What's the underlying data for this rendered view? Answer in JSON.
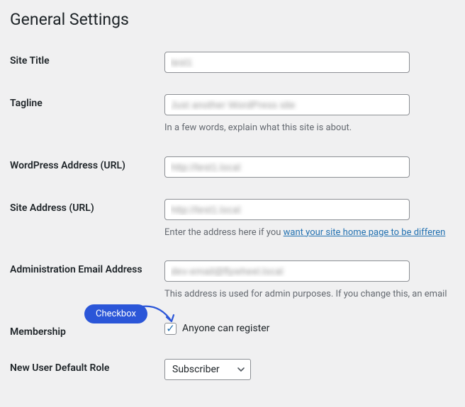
{
  "page_title": "General Settings",
  "fields": {
    "site_title": {
      "label": "Site Title",
      "value": "test1"
    },
    "tagline": {
      "label": "Tagline",
      "value": "Just another WordPress site",
      "help": "In a few words, explain what this site is about."
    },
    "wp_address": {
      "label": "WordPress Address (URL)",
      "value": "http://test1.local"
    },
    "site_address": {
      "label": "Site Address (URL)",
      "value": "http://test1.local",
      "help_prefix": "Enter the address here if you ",
      "help_link": "want your site home page to be differen"
    },
    "admin_email": {
      "label": "Administration Email Address",
      "value": "dev-email@flywheel.local",
      "help": "This address is used for admin purposes. If you change this, an email"
    },
    "membership": {
      "label": "Membership",
      "checkbox_label": "Anyone can register",
      "checked": true
    },
    "default_role": {
      "label": "New User Default Role",
      "selected": "Subscriber"
    }
  },
  "annotation": {
    "label": "Checkbox"
  }
}
